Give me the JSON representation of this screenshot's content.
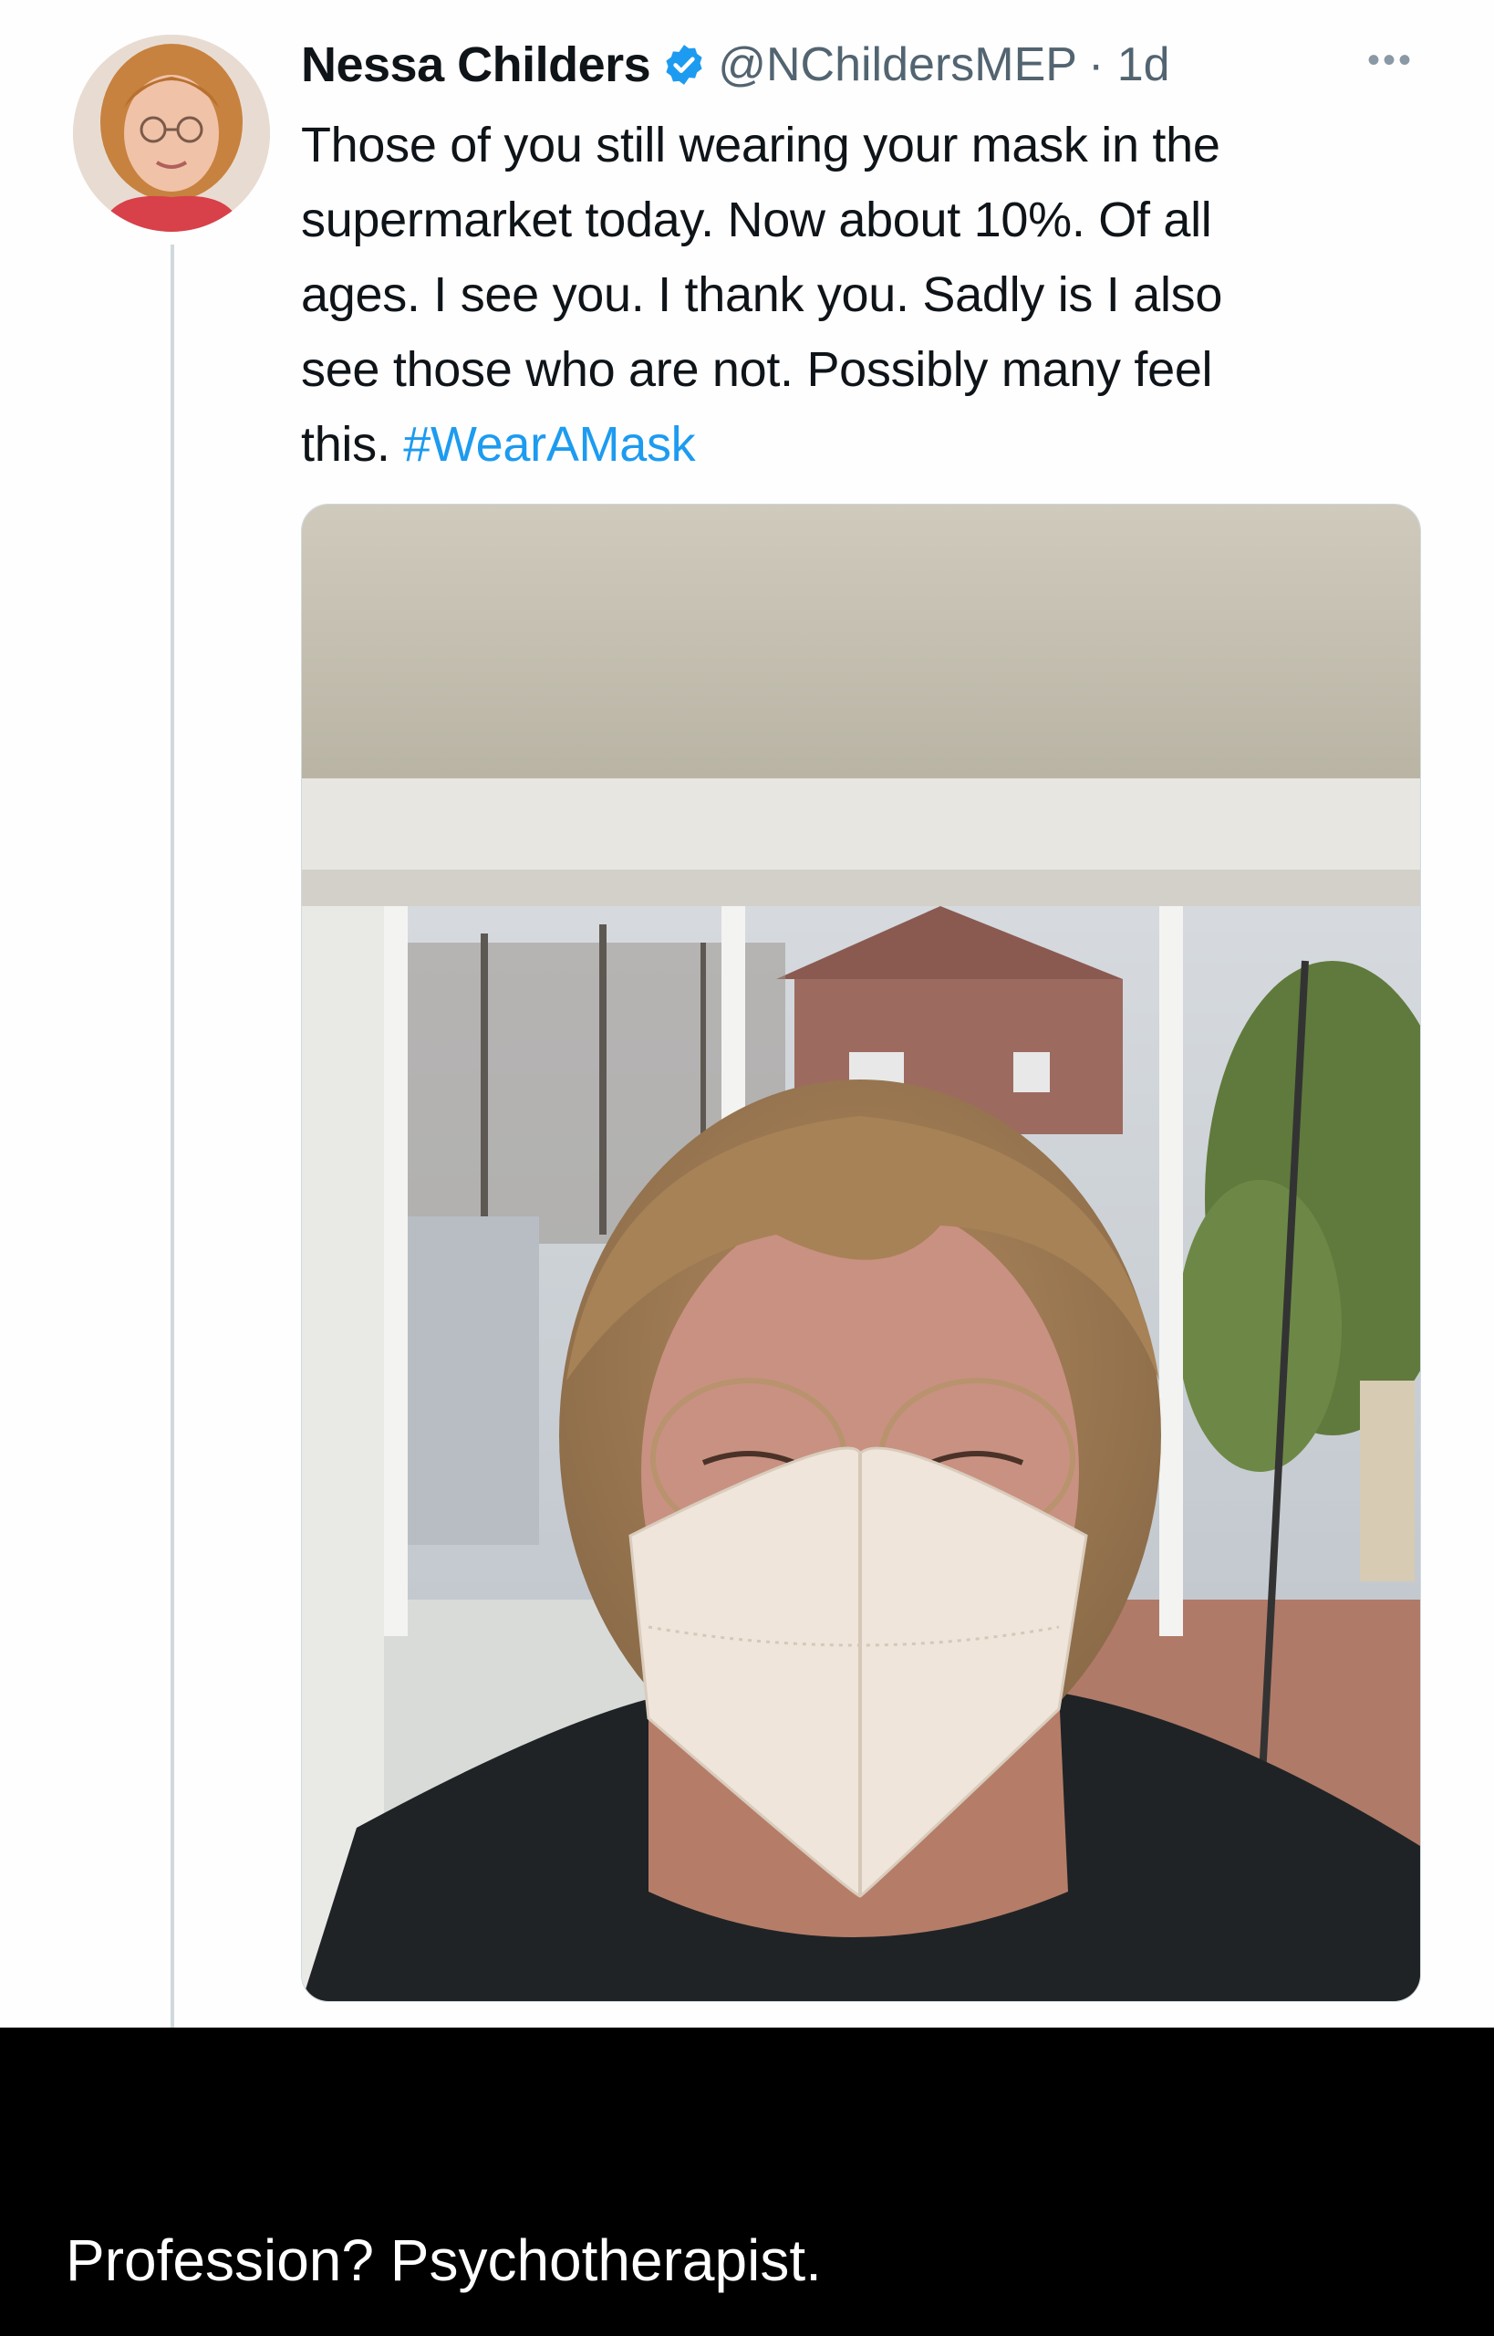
{
  "tweet": {
    "author_name": "Nessa Childers",
    "handle": "@NChildersMEP",
    "time": "· 1d",
    "more_icon": "more-dots-icon",
    "verified_icon": "verified-badge-icon",
    "text_lines": [
      "Those of you still wearing your mask in the",
      "supermarket today. Now about 10%. Of all",
      "ages. I see you. I thank you. Sadly is I also",
      "see those who are not. Possibly many feel",
      "this."
    ],
    "hashtag": "#WearAMask",
    "colors": {
      "hashtag": "#1d9bf0",
      "verified": "#1d9bf0",
      "caption_bg": "#000000"
    }
  },
  "caption": {
    "text": "Profession? Psychotherapist."
  }
}
